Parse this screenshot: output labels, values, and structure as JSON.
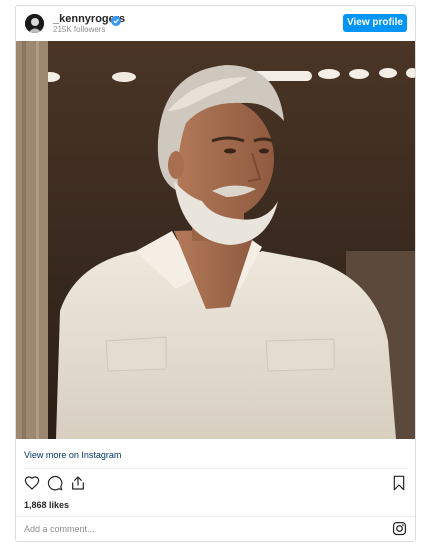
{
  "post": {
    "username": "_kennyrogers",
    "followers": "215K followers",
    "view_profile_label": "View profile",
    "view_more_label": "View more on Instagram",
    "likes": "1,868 likes",
    "comment_placeholder": "Add a comment..."
  },
  "icons": {
    "verified": "verified-badge-icon",
    "like": "heart-icon",
    "comment": "comment-icon",
    "share": "share-icon",
    "save": "bookmark-icon",
    "instagram": "instagram-icon"
  },
  "colors": {
    "accent": "#0095f6",
    "link": "#00376b",
    "muted": "#8e8e8e"
  }
}
